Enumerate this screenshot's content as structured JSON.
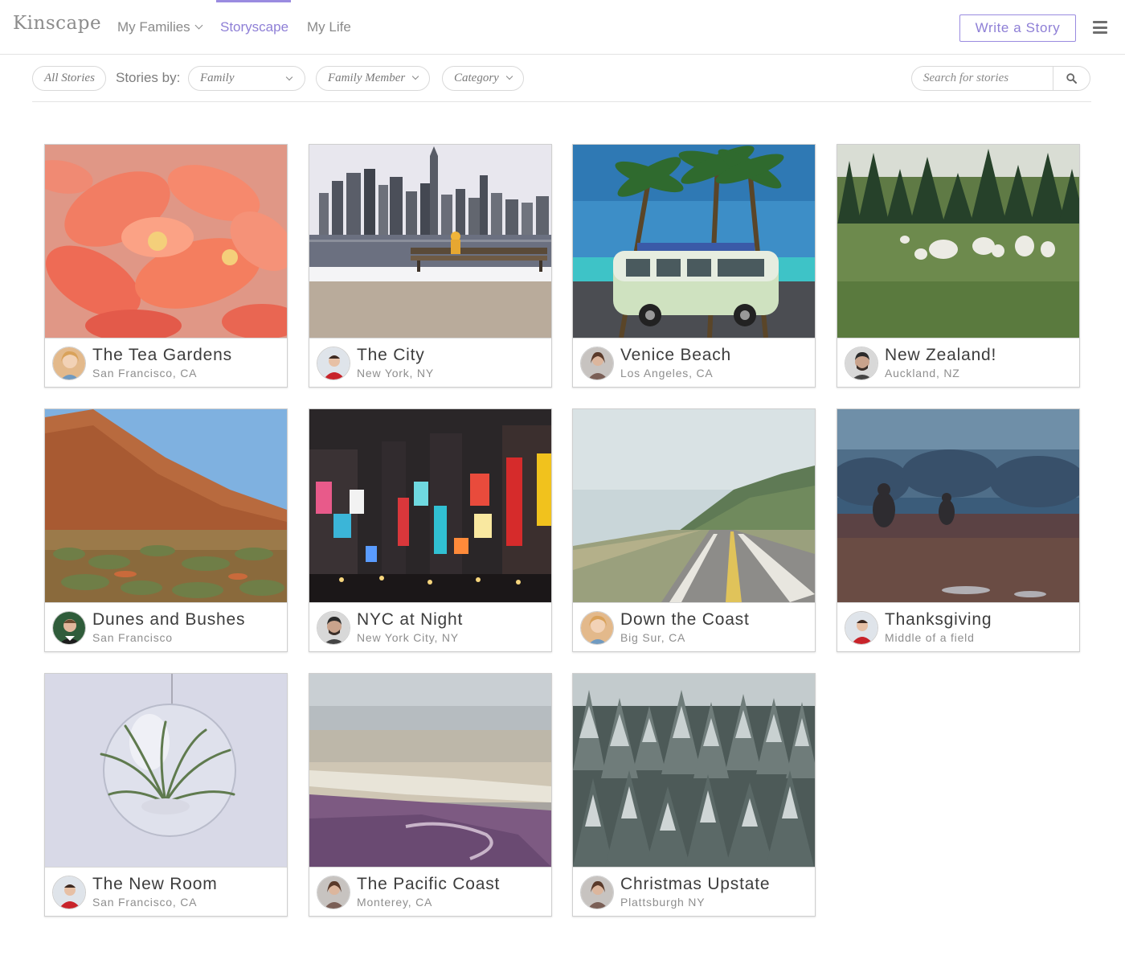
{
  "header": {
    "logo": "Kinscape",
    "nav": [
      {
        "label": "My Families",
        "dropdown": true
      },
      {
        "label": "Storyscape",
        "active": true
      },
      {
        "label": "My Life"
      }
    ],
    "write_button": "Write a Story",
    "menu_icon": "hamburger-menu-icon",
    "accent_color": "#8e7fd6"
  },
  "filters": {
    "all_stories": "All Stories",
    "stories_by_label": "Stories by:",
    "family": "Family",
    "family_member": "Family Member",
    "category": "Category",
    "search_placeholder": "Search for stories",
    "search_icon": "search-icon"
  },
  "stories": [
    {
      "title": "The Tea Gardens",
      "location": "San Francisco, CA",
      "image": "orange-flowers"
    },
    {
      "title": "The City",
      "location": "New York, NY",
      "image": "city-skyline-bench"
    },
    {
      "title": "Venice Beach",
      "location": "Los Angeles, CA",
      "image": "palm-trees-van"
    },
    {
      "title": "New Zealand!",
      "location": "Auckland, NZ",
      "image": "sheep-field"
    },
    {
      "title": "Dunes and Bushes",
      "location": "San Francisco",
      "image": "desert-rock"
    },
    {
      "title": "NYC at Night",
      "location": "New York City, NY",
      "image": "times-square-night"
    },
    {
      "title": "Down the Coast",
      "location": "Big Sur, CA",
      "image": "coastal-road-fog"
    },
    {
      "title": "Thanksgiving",
      "location": "Middle of a field",
      "image": "foggy-field-figures"
    },
    {
      "title": "The New Room",
      "location": "San Francisco, CA",
      "image": "glass-terrarium"
    },
    {
      "title": "The Pacific Coast",
      "location": "Monterey, CA",
      "image": "beach-aerial"
    },
    {
      "title": "Christmas Upstate",
      "location": "Plattsburgh NY",
      "image": "snowy-forest"
    }
  ]
}
